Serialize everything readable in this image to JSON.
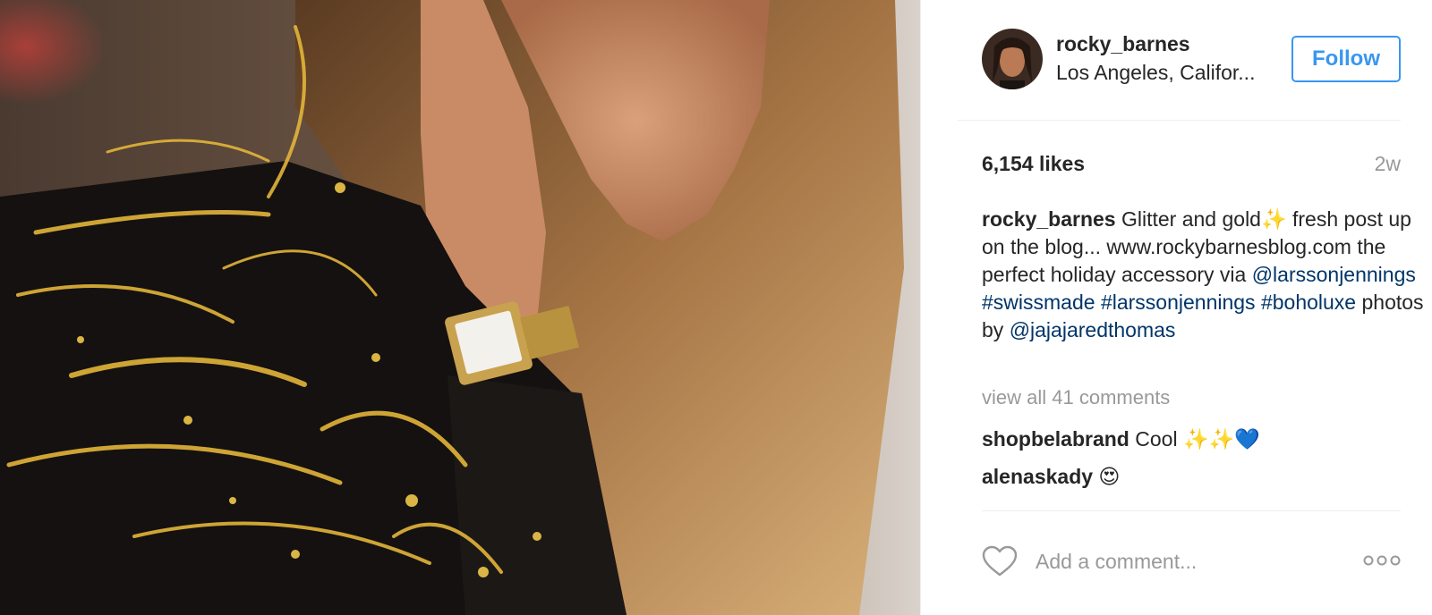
{
  "post": {
    "author": {
      "username": "rocky_barnes",
      "location": "Los Angeles, Califor..."
    },
    "follow_label": "Follow",
    "likes": "6,154 likes",
    "age": "2w",
    "caption": {
      "username": "rocky_barnes",
      "text_1": "Glitter and gold",
      "text_2": " fresh post up on the blog... www.rockybarnesblog.com the perfect holiday accessory via ",
      "mention_brand": "@larssonjennings",
      "hashtag_1": "#swissmade",
      "hashtag_2": "#larssonjennings",
      "hashtag_3": "#boholuxe",
      "text_3": "photos by ",
      "mention_photographer": "@jajajaredthomas"
    },
    "view_all_comments": "view all 41 comments",
    "comments": [
      {
        "username": "shopbelabrand",
        "text": "Cool ✨✨💙"
      },
      {
        "username": "alenaskady",
        "text": "😍"
      },
      {
        "username": "",
        "text": ""
      }
    ],
    "composer": {
      "placeholder": "Add a comment..."
    }
  },
  "icons": {
    "like": "heart-icon",
    "more": "more-options-icon",
    "sparkle": "sparkles-emoji"
  },
  "colors": {
    "accent": "#3897f0",
    "link": "#003569",
    "muted": "#999999",
    "text": "#262626",
    "divider": "#efefef"
  }
}
